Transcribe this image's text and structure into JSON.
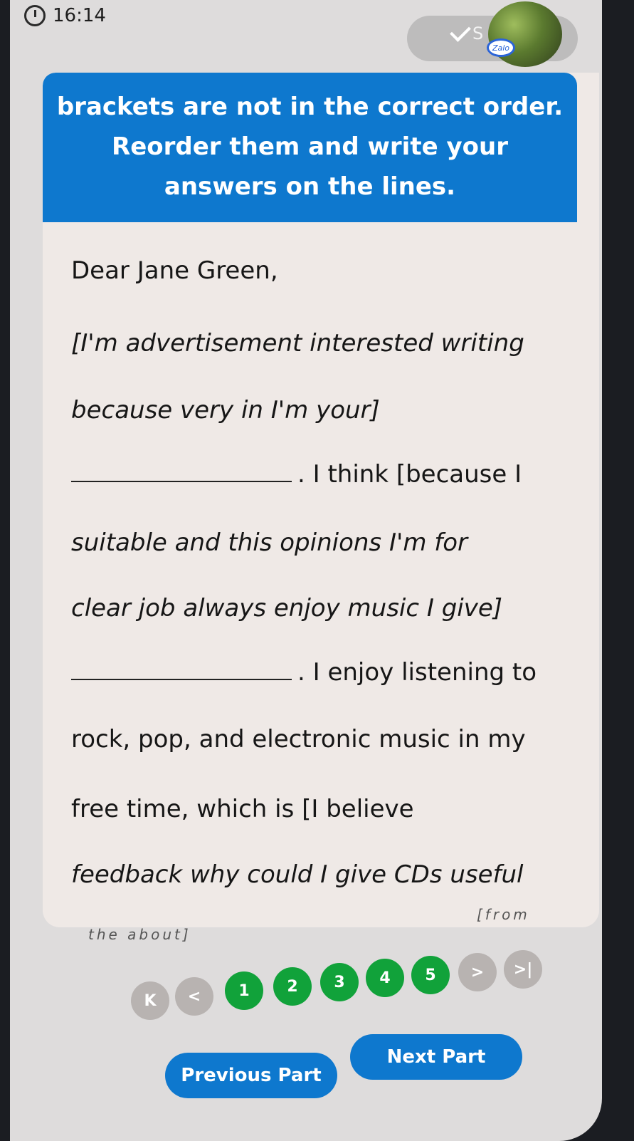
{
  "status": {
    "time": "16:14",
    "icon": "clock-icon"
  },
  "notification": {
    "text": "S",
    "badge": "Zalo"
  },
  "instruction": {
    "lines": [
      "brackets are not in the correct order.",
      "Reorder them and write your",
      "answers on the lines."
    ]
  },
  "letter": {
    "greeting": "Dear Jane Green,",
    "line1": "[I'm advertisement interested writing",
    "line2": "because very in I'm your]",
    "line3_after": ". I think [because I",
    "line4": "suitable and this opinions I'm for",
    "line5": "clear job always enjoy music I give]",
    "line6_after": ". I enjoy listening to",
    "line7": "rock, pop, and electronic music in my",
    "line8": "free time, which is [I believe",
    "line9": "feedback why could I give CDs useful",
    "cut_left": "the about]",
    "cut_right": "[from"
  },
  "pagination": {
    "first": "K",
    "prev": "<",
    "pages": [
      "1",
      "2",
      "3",
      "4",
      "5"
    ],
    "next": ">",
    "last": ">|"
  },
  "nav": {
    "previous": "Previous Part",
    "next": "Next Part"
  },
  "colors": {
    "accent": "#0e78ce",
    "page_active": "#11a23a"
  }
}
